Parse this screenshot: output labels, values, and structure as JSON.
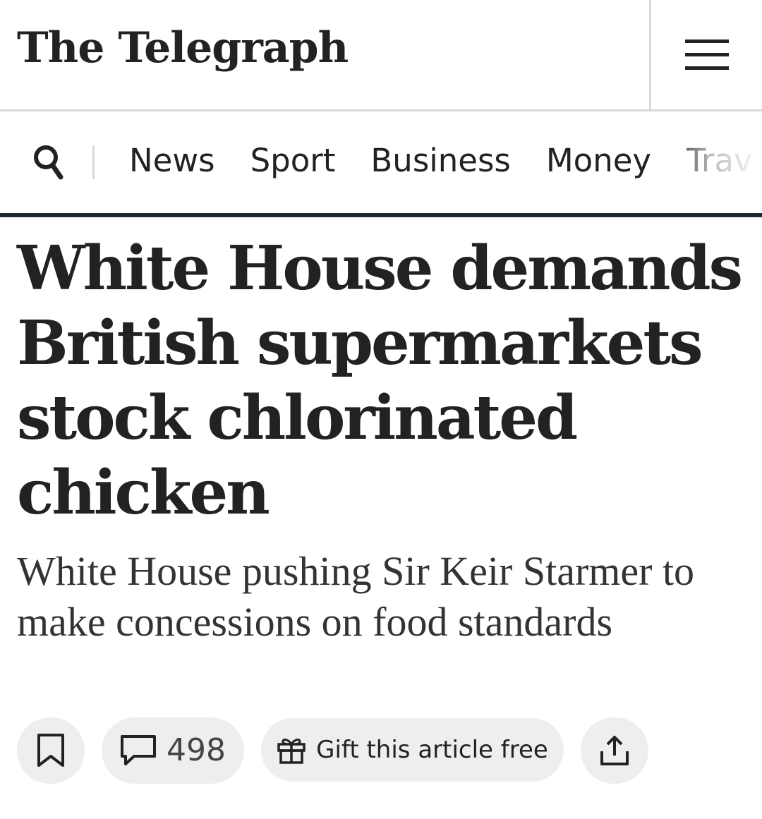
{
  "header": {
    "logo_text": "The Telegraph",
    "menu_icon": "hamburger-menu-icon"
  },
  "nav": {
    "search_icon": "search-icon",
    "items": [
      {
        "label": "News"
      },
      {
        "label": "Sport"
      },
      {
        "label": "Business"
      },
      {
        "label": "Money"
      },
      {
        "label": "Trav"
      }
    ]
  },
  "article": {
    "headline": "White House demands British supermarkets stock chlorinated chicken",
    "standfirst": "White House pushing Sir Keir Starmer to make concessions on food standards"
  },
  "actions": {
    "bookmark_icon": "bookmark-icon",
    "comment_icon": "comment-icon",
    "comments_count": "498",
    "gift_icon": "gift-icon",
    "gift_label": "Gift this article free",
    "share_icon": "share-icon"
  },
  "colors": {
    "text": "#222222",
    "nav_rule": "#1b2733",
    "button_bg": "#eeeeee",
    "divider": "#d9d9d9"
  }
}
